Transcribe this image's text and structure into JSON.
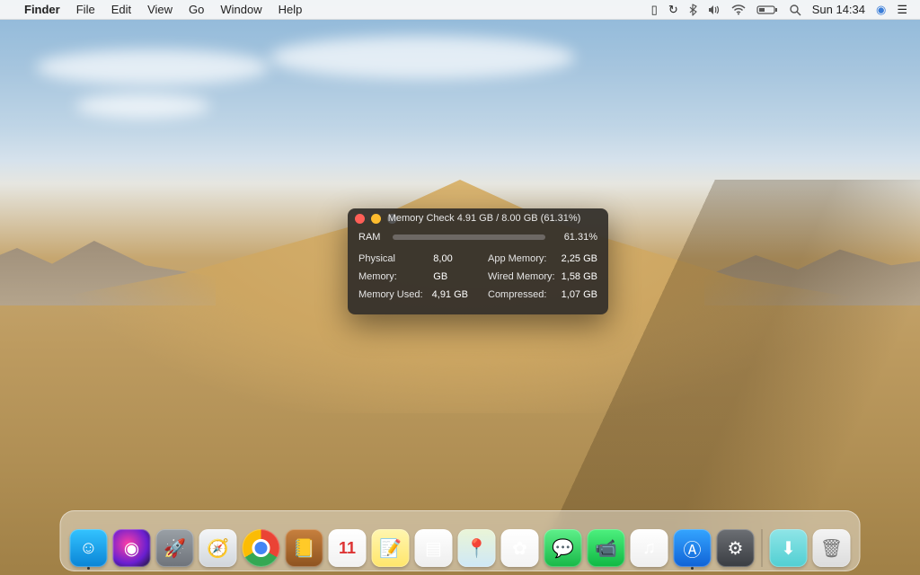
{
  "menubar": {
    "app": "Finder",
    "items": [
      "File",
      "Edit",
      "View",
      "Go",
      "Window",
      "Help"
    ],
    "right": {
      "clock": "Sun 14:34"
    }
  },
  "window": {
    "title": "Memory Check 4.91 GB / 8.00 GB (61.31%)",
    "ram_label": "RAM",
    "percent_text": "61.31%",
    "percent_value": 61.31,
    "left": [
      {
        "k": "Physical Memory:",
        "v": "8,00 GB"
      },
      {
        "k": "Memory Used:",
        "v": "4,91 GB"
      }
    ],
    "right": [
      {
        "k": "App Memory:",
        "v": "2,25 GB"
      },
      {
        "k": "Wired Memory:",
        "v": "1,58 GB"
      },
      {
        "k": "Compressed:",
        "v": "1,07 GB"
      }
    ]
  },
  "dock": [
    {
      "name": "finder",
      "bg": "linear-gradient(#34c3ff,#0a84d6)",
      "glyph": "☺",
      "running": true
    },
    {
      "name": "siri",
      "bg": "radial-gradient(circle at 40% 40%,#ff3ea5,#6a1fd0 60%,#151722)",
      "glyph": "◉",
      "running": false
    },
    {
      "name": "launchpad",
      "bg": "linear-gradient(#9aa0a6,#6e737a)",
      "glyph": "🚀",
      "running": false
    },
    {
      "name": "safari",
      "bg": "linear-gradient(#f4f6f8,#d1d6db)",
      "glyph": "🧭",
      "running": false
    },
    {
      "name": "chrome",
      "bg": "conic-gradient(#ea4335 0 120deg,#34a853 120deg 240deg,#fbbc05 240deg 360deg)",
      "glyph": "",
      "running": false
    },
    {
      "name": "contacts",
      "bg": "linear-gradient(#c7803e,#8e531f)",
      "glyph": "📒",
      "running": false
    },
    {
      "name": "calendar",
      "bg": "linear-gradient(#fff,#f1f1f1)",
      "glyph": "11",
      "running": false
    },
    {
      "name": "notes",
      "bg": "linear-gradient(#fff6b0,#ffe66b)",
      "glyph": "📝",
      "running": false
    },
    {
      "name": "reminders",
      "bg": "linear-gradient(#fff,#eee)",
      "glyph": "▤",
      "running": false
    },
    {
      "name": "maps",
      "bg": "linear-gradient(#eaf5d7,#cfe8f6)",
      "glyph": "📍",
      "running": false
    },
    {
      "name": "photos",
      "bg": "linear-gradient(#fff,#f3f3f3)",
      "glyph": "✿",
      "running": false
    },
    {
      "name": "messages",
      "bg": "linear-gradient(#5ef08a,#18b847)",
      "glyph": "💬",
      "running": false
    },
    {
      "name": "facetime",
      "bg": "linear-gradient(#4df07e,#0fb843)",
      "glyph": "📹",
      "running": false
    },
    {
      "name": "itunes",
      "bg": "linear-gradient(#fff,#efefef)",
      "glyph": "♫",
      "running": false
    },
    {
      "name": "appstore",
      "bg": "linear-gradient(#34a5ff,#1062d6)",
      "glyph": "Ⓐ",
      "running": true
    },
    {
      "name": "system-preferences",
      "bg": "linear-gradient(#6c6f74,#3a3d42)",
      "glyph": "⚙",
      "running": false
    }
  ],
  "dock_right": [
    {
      "name": "downloads",
      "bg": "linear-gradient(#8fe5e7,#51cfd2)",
      "glyph": "⬇"
    },
    {
      "name": "trash",
      "bg": "",
      "glyph": "🗑"
    }
  ]
}
